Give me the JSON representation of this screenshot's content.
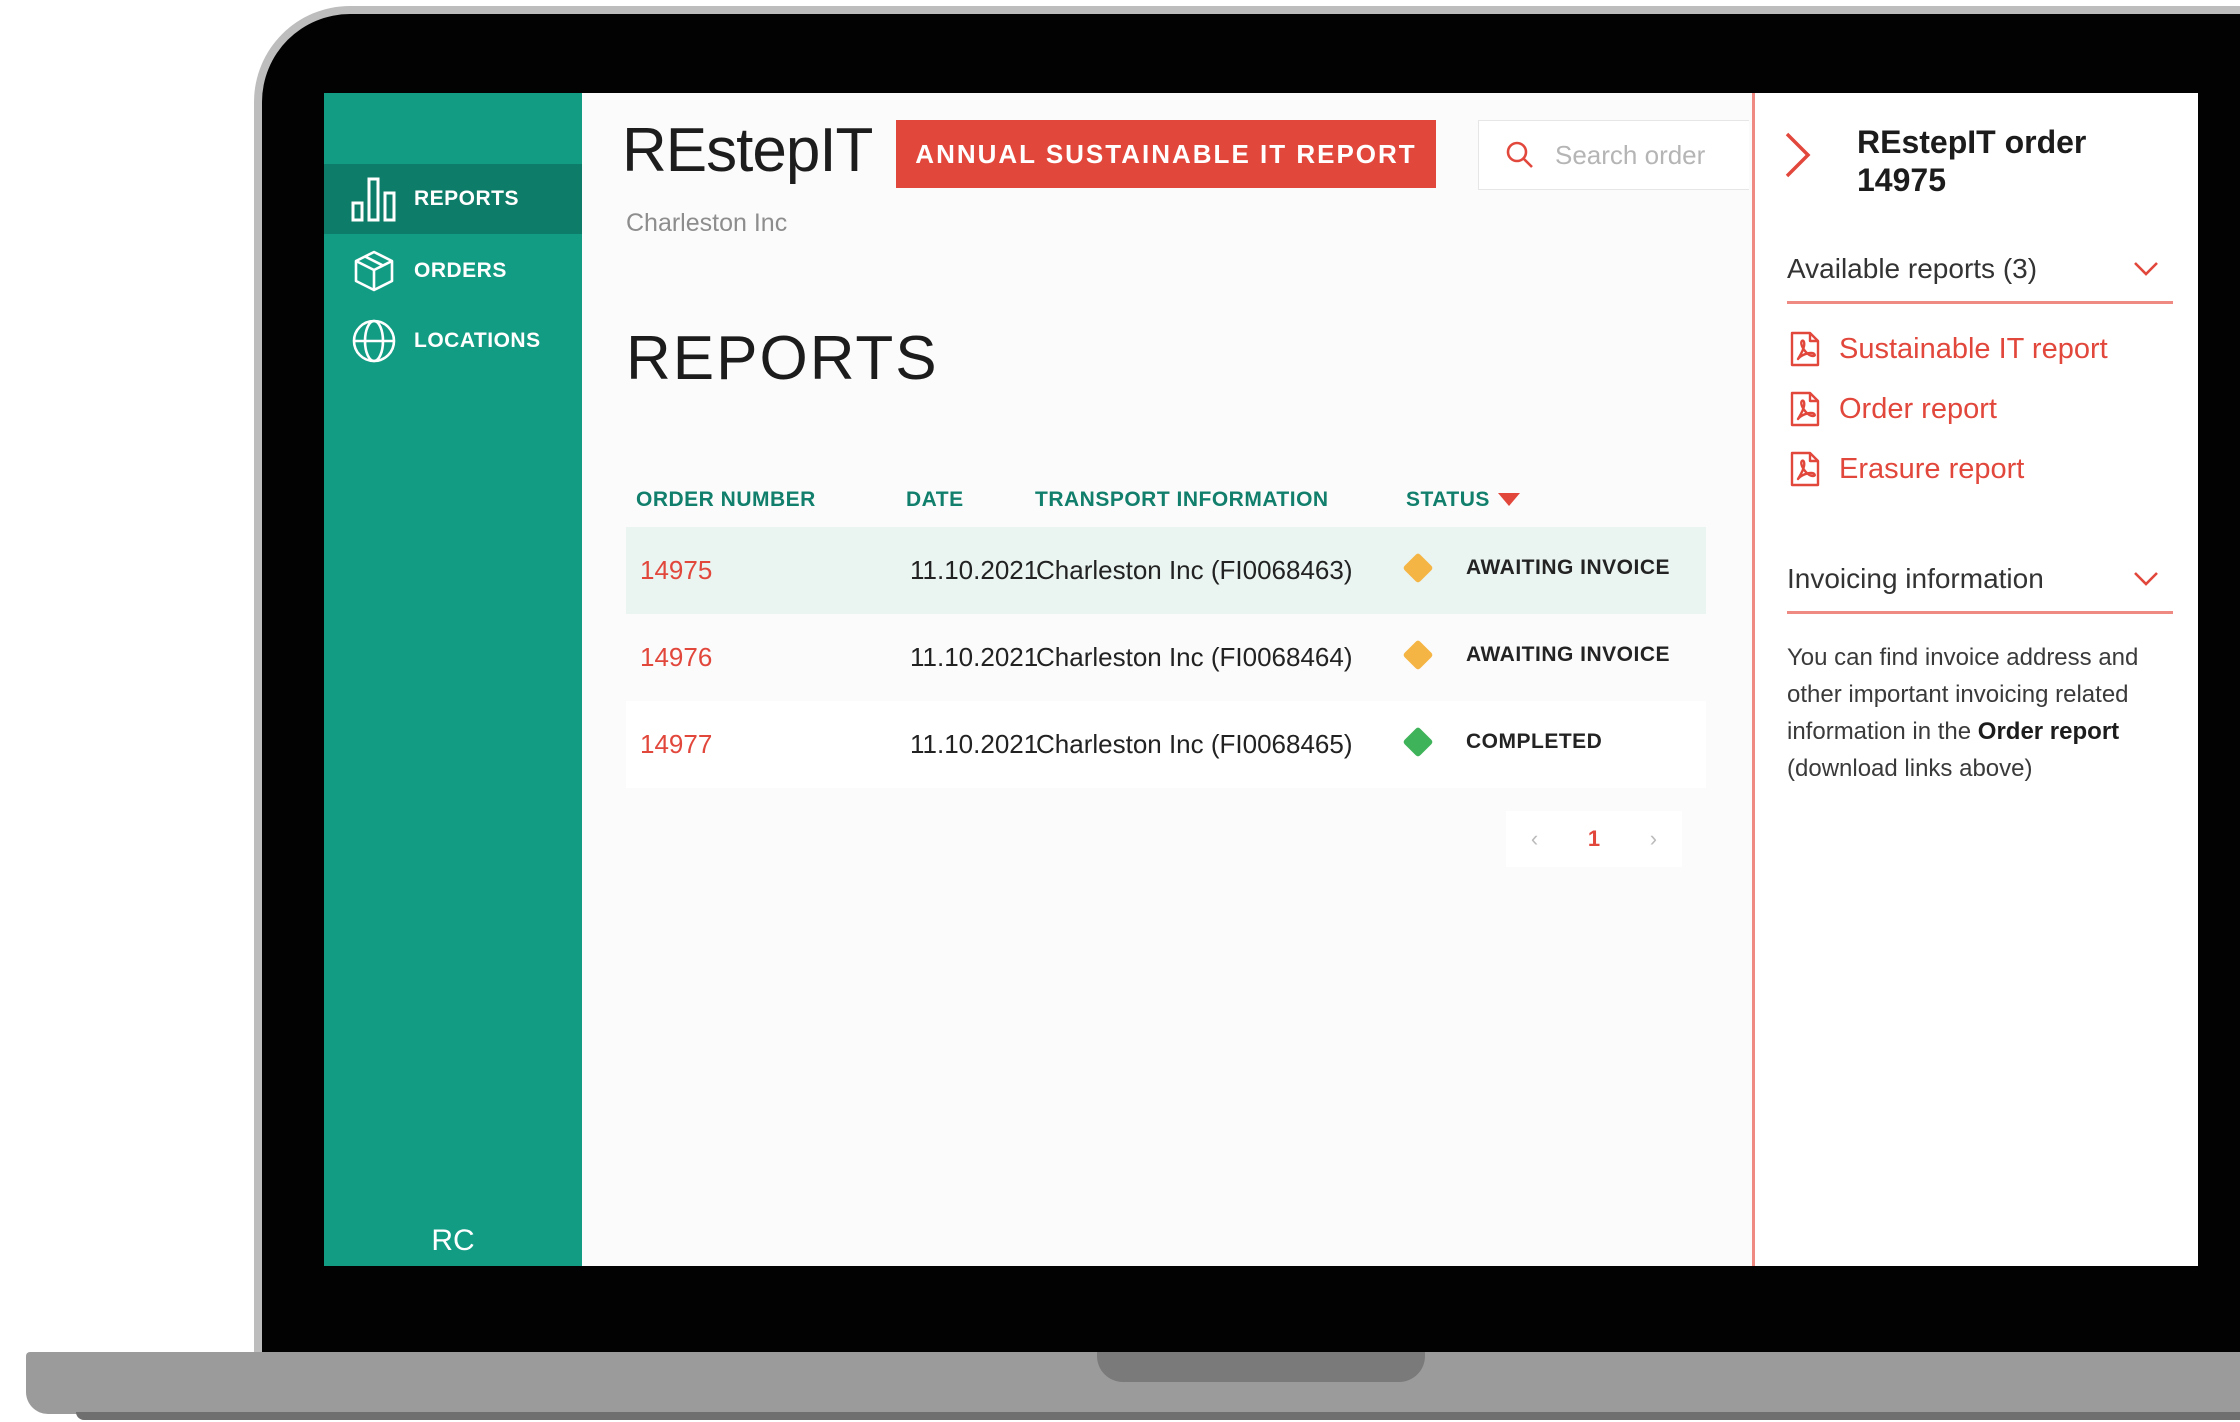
{
  "brand": {
    "logo_text": "REstepIT",
    "company": "Charleston Inc",
    "accent": "#e2473c",
    "sidebar_color": "#139c84"
  },
  "sidebar": {
    "items": [
      {
        "label": "REPORTS",
        "icon": "bar-chart-icon",
        "active": true
      },
      {
        "label": "ORDERS",
        "icon": "box-icon",
        "active": false
      },
      {
        "label": "LOCATIONS",
        "icon": "globe-icon",
        "active": false
      }
    ],
    "avatar_initials": "RC"
  },
  "header": {
    "annual_button": "ANNUAL SUSTAINABLE IT REPORT",
    "search_placeholder": "Search order"
  },
  "page_title": "REPORTS",
  "table": {
    "columns": [
      "ORDER NUMBER",
      "DATE",
      "TRANSPORT INFORMATION",
      "STATUS"
    ],
    "rows": [
      {
        "order": "14975",
        "date": "11.10.2021",
        "transport": "Charleston Inc (FI0068463)",
        "status": "AWAITING INVOICE",
        "status_color": "#f5b544"
      },
      {
        "order": "14976",
        "date": "11.10.2021",
        "transport": "Charleston Inc (FI0068464)",
        "status": "AWAITING INVOICE",
        "status_color": "#f5b544"
      },
      {
        "order": "14977",
        "date": "11.10.2021",
        "transport": "Charleston Inc (FI0068465)",
        "status": "COMPLETED",
        "status_color": "#3fb35a"
      }
    ],
    "pagination": {
      "current_page": "1"
    }
  },
  "panel": {
    "title": "REstepIT order 14975",
    "reports_heading": "Available reports (3)",
    "reports": [
      "Sustainable IT report",
      "Order report",
      "Erasure report"
    ],
    "invoicing_heading": "Invoicing information",
    "invoicing_text_before": "You can find invoice address and other important invoicing related information in the ",
    "invoicing_text_bold": "Order report",
    "invoicing_text_after": " (download links above)"
  }
}
